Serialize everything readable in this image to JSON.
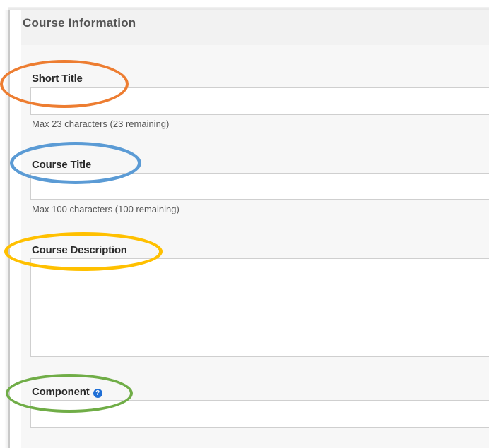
{
  "section": {
    "title": "Course Information"
  },
  "fields": {
    "short_title": {
      "label": "Short Title",
      "value": "",
      "hint": "Max 23 characters (23 remaining)"
    },
    "course_title": {
      "label": "Course Title",
      "value": "",
      "hint": "Max 100 characters (100 remaining)"
    },
    "course_description": {
      "label": "Course Description",
      "value": ""
    },
    "component": {
      "label": "Component",
      "value": "",
      "help_icon": "question-circle-icon",
      "help_glyph": "?"
    }
  },
  "annotations": {
    "colors": {
      "short_title": "#ed7d31",
      "course_title": "#5b9bd5",
      "course_description": "#ffc000",
      "component": "#70ad47"
    }
  }
}
